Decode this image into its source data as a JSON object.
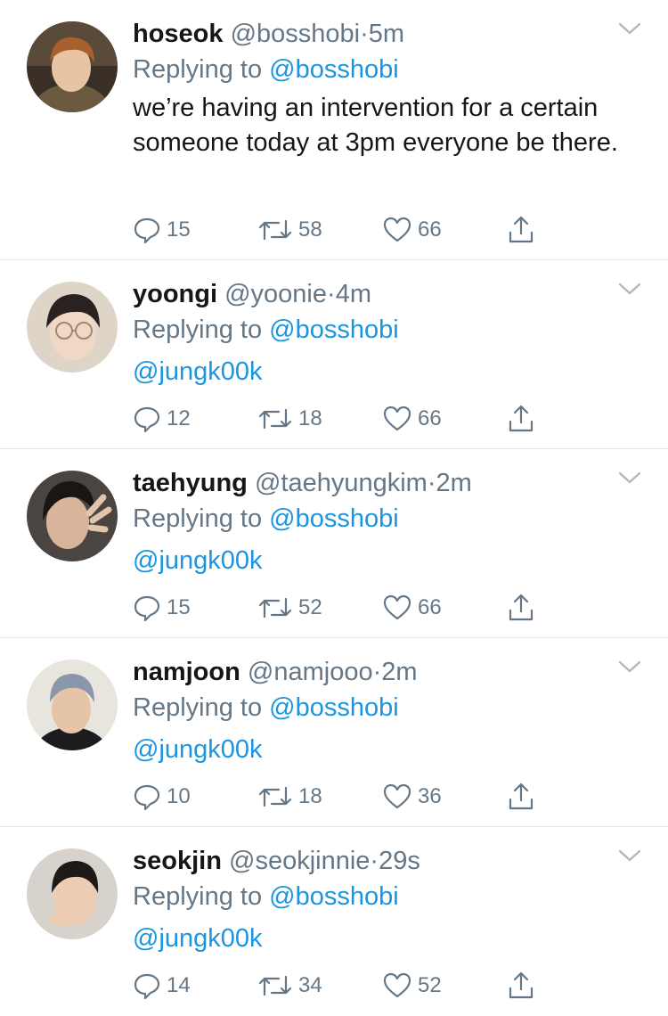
{
  "tweets": [
    {
      "name": "hoseok",
      "handle": "@bosshobi",
      "dot": "·",
      "time": "5m",
      "replying_label": "Replying to",
      "replying_to": "@bosshobi",
      "text": "we’re having an intervention for a certain someone today at 3pm everyone be there.",
      "replies": "15",
      "retweets": "58",
      "likes": "66"
    },
    {
      "name": "yoongi",
      "handle": "@yoonie",
      "dot": "·",
      "time": "4m",
      "replying_label": "Replying to",
      "replying_to": "@bosshobi",
      "text": "@jungk00k",
      "replies": "12",
      "retweets": "18",
      "likes": "66"
    },
    {
      "name": "taehyung",
      "handle": "@taehyungkim",
      "dot": "·",
      "time": "2m",
      "replying_label": "Replying to",
      "replying_to": "@bosshobi",
      "text": "@jungk00k",
      "replies": "15",
      "retweets": "52",
      "likes": "66"
    },
    {
      "name": "namjoon",
      "handle": "@namjooo",
      "dot": "·",
      "time": "2m",
      "replying_label": "Replying to",
      "replying_to": "@bosshobi",
      "text": "@jungk00k",
      "replies": "10",
      "retweets": "18",
      "likes": "36"
    },
    {
      "name": "seokjin",
      "handle": "@seokjinnie",
      "dot": "·",
      "time": "29s",
      "replying_label": "Replying to",
      "replying_to": "@bosshobi",
      "text": "@jungk00k",
      "replies": "14",
      "retweets": "34",
      "likes": "52"
    }
  ],
  "colors": {
    "link": "#1b95e0",
    "muted": "#657786",
    "text": "#14171a",
    "divider": "#e1e4e8"
  },
  "icons": {
    "reply": "speech-bubble-icon",
    "retweet": "retweet-arrows-icon",
    "like": "heart-outline-icon",
    "share": "share-upload-icon",
    "menu": "chevron-down-icon"
  }
}
